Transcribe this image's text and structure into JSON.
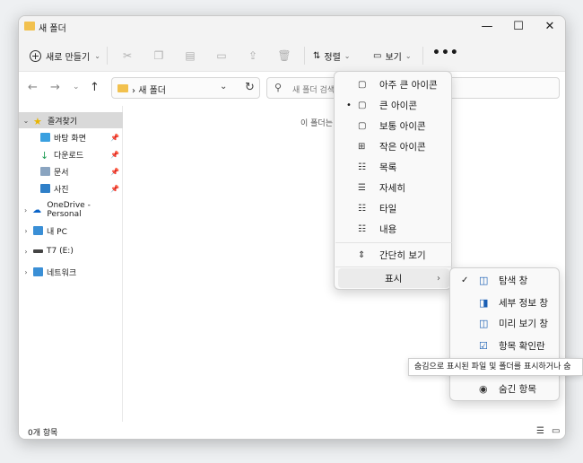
{
  "window": {
    "title": "새 폴더",
    "minimize": "—",
    "maximize": "☐",
    "close": "✕"
  },
  "toolbar": {
    "new_label": "새로 만들기",
    "sort_label": "정렬",
    "view_label": "보기",
    "more": "•••"
  },
  "address": {
    "folder": "새 폴더",
    "separator": "›",
    "search_placeholder": "새 폴더 검색"
  },
  "sidebar": {
    "quick_access": "즐겨찾기",
    "desktop": "바탕 화면",
    "downloads": "다운로드",
    "documents": "문서",
    "pictures": "사진",
    "onedrive": "OneDrive - Personal",
    "pc": "내 PC",
    "drive": "T7 (E:)",
    "network": "네트워크"
  },
  "content": {
    "empty_text": "이 폴더는"
  },
  "status": {
    "item_count": "0개 항목"
  },
  "view_menu": {
    "items": [
      {
        "label": "아주 큰 아이콘",
        "icon": "monitor-icon"
      },
      {
        "label": "큰 아이콘",
        "icon": "monitor-icon",
        "selected": true
      },
      {
        "label": "보통 아이콘",
        "icon": "monitor-icon"
      },
      {
        "label": "작은 아이콘",
        "icon": "grid-icon"
      },
      {
        "label": "목록",
        "icon": "list-icon"
      },
      {
        "label": "자세히",
        "icon": "details-icon"
      },
      {
        "label": "타일",
        "icon": "tiles-icon"
      },
      {
        "label": "내용",
        "icon": "content-icon"
      }
    ],
    "compact": "간단히 보기",
    "show": "표시"
  },
  "show_menu": {
    "items": [
      {
        "label": "탐색 창",
        "checked": true
      },
      {
        "label": "세부 정보 창",
        "checked": false
      },
      {
        "label": "미리 보기 창",
        "checked": false
      },
      {
        "label": "항목 확인란",
        "checked": false
      },
      {
        "label": "숨긴 항목",
        "checked": false
      }
    ]
  },
  "tooltip": {
    "text": "숨김으로 표시된 파일 및 폴더를 표시하거나 숨"
  },
  "colors": {
    "folder": "#f2c14e",
    "accent": "#1a5fb4"
  }
}
